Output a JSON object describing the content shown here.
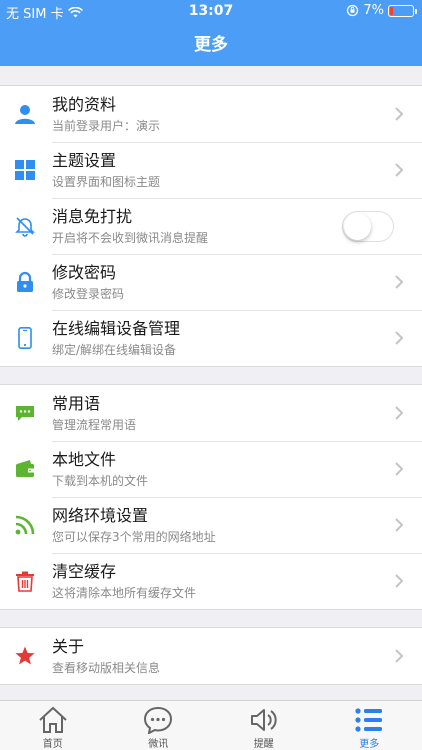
{
  "status_bar": {
    "carrier": "无 SIM 卡",
    "time": "13:07",
    "battery_percent": "7%",
    "battery_level": 0.07
  },
  "nav": {
    "title": "更多"
  },
  "groups": [
    {
      "items": [
        {
          "title": "我的资料",
          "subtitle": "当前登录用户：演示",
          "icon": "person-icon",
          "icon_color": "#2f8ef0"
        },
        {
          "title": "主题设置",
          "subtitle": "设置界面和图标主题",
          "icon": "grid-icon",
          "icon_color": "#2f8ef0"
        },
        {
          "title": "消息免打扰",
          "subtitle": "开启将不会收到微讯消息提醒",
          "icon": "bell-off-icon",
          "icon_color": "#2f8ef0",
          "toggle_on": false
        },
        {
          "title": "修改密码",
          "subtitle": "修改登录密码",
          "icon": "lock-icon",
          "icon_color": "#2f8ef0"
        },
        {
          "title": "在线编辑设备管理",
          "subtitle": "绑定/解绑在线编辑设备",
          "icon": "phone-icon",
          "icon_color": "#2f8ef0"
        }
      ]
    },
    {
      "items": [
        {
          "title": "常用语",
          "subtitle": "管理流程常用语",
          "icon": "chat-icon",
          "icon_color": "#5cb531"
        },
        {
          "title": "本地文件",
          "subtitle": "下载到本机的文件",
          "icon": "wallet-icon",
          "icon_color": "#5cb531"
        },
        {
          "title": "网络环境设置",
          "subtitle": "您可以保存3个常用的网络地址",
          "icon": "rss-icon",
          "icon_color": "#5cb531"
        },
        {
          "title": "清空缓存",
          "subtitle": "这将清除本地所有缓存文件",
          "icon": "trash-icon",
          "icon_color": "#e53935"
        }
      ]
    },
    {
      "items": [
        {
          "title": "关于",
          "subtitle": "查看移动版相关信息",
          "icon": "star-icon",
          "icon_color": "#e53935"
        }
      ]
    }
  ],
  "tabbar": [
    {
      "label": "首页",
      "icon": "home-icon",
      "active": false
    },
    {
      "label": "微讯",
      "icon": "message-icon",
      "active": false
    },
    {
      "label": "提醒",
      "icon": "speaker-icon",
      "active": false
    },
    {
      "label": "更多",
      "icon": "list-icon",
      "active": true
    }
  ],
  "colors": {
    "accent": "#4b9df5",
    "tab_active": "#2b7ff0"
  }
}
